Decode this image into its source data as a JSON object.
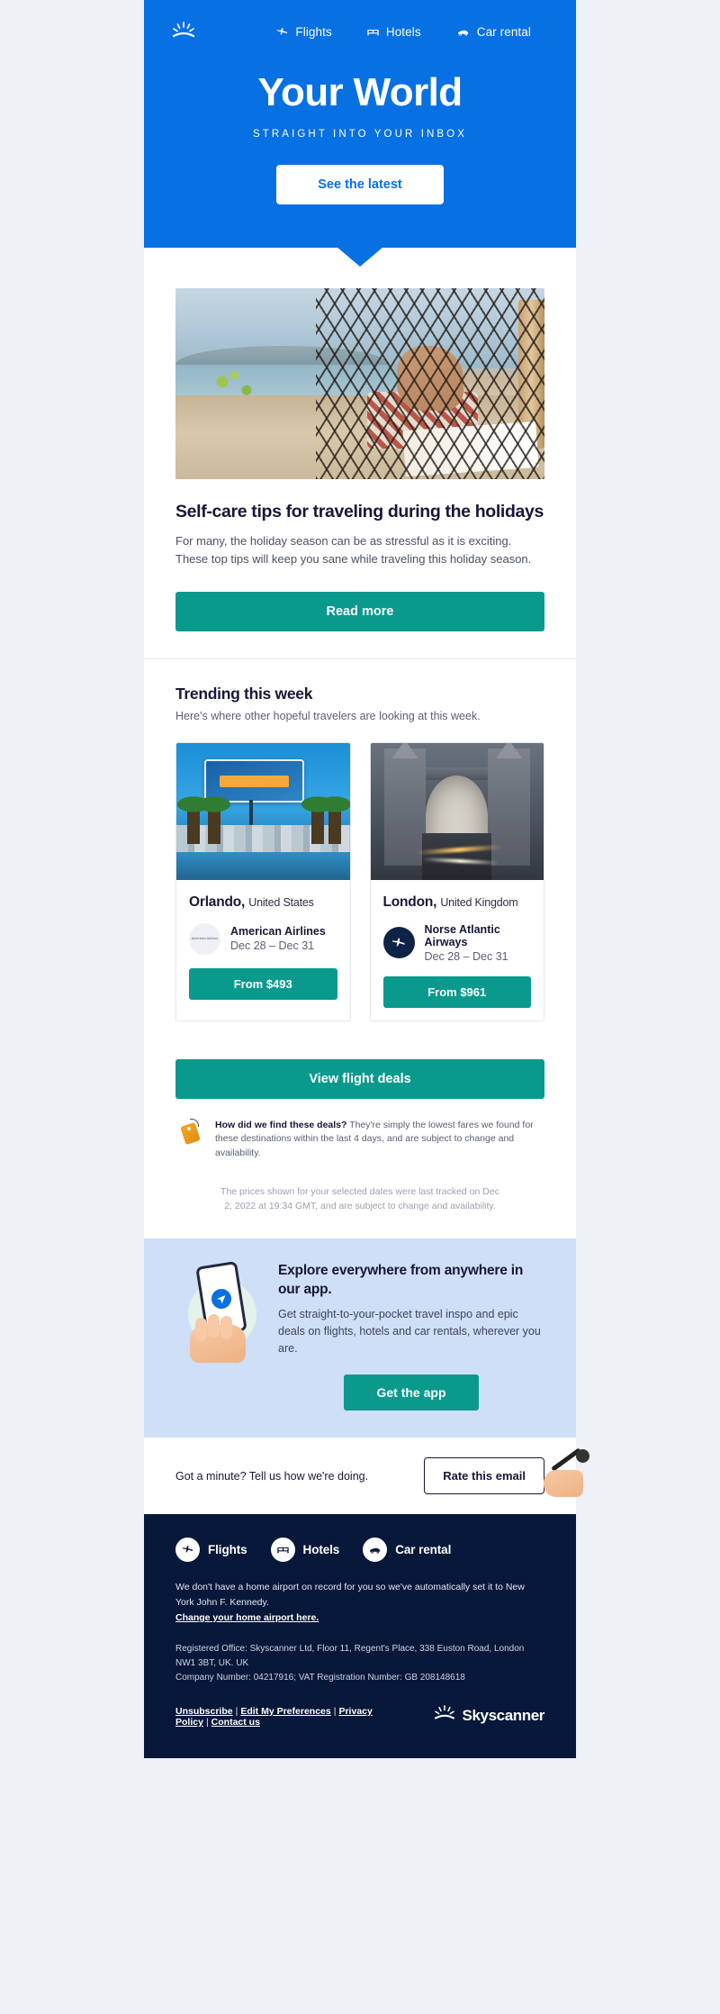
{
  "hero": {
    "logo_name": "skyscanner-sun-logo",
    "nav": [
      {
        "label": "Flights",
        "icon": "plane-icon"
      },
      {
        "label": "Hotels",
        "icon": "bed-icon"
      },
      {
        "label": "Car rental",
        "icon": "car-icon"
      }
    ],
    "title": "Your World",
    "subtitle": "STRAIGHT INTO YOUR INBOX",
    "cta_label": "See the latest",
    "bg_color": "#0770e3"
  },
  "article": {
    "image_alt": "person relaxing in a hammock on a beach reading a book",
    "title": "Self-care tips for traveling during the holidays",
    "body": "For many, the holiday season can be as stressful as it is exciting. These top tips will keep you sane while traveling this holiday season.",
    "cta_label": "Read more"
  },
  "trending": {
    "title": "Trending this week",
    "subtitle": "Here's where other hopeful travelers are looking at this week.",
    "cards": [
      {
        "image_alt": "Welcome to Orlando sign with palm trees",
        "city": "Orlando,",
        "country": "United States",
        "airline": "American Airlines",
        "airline_logo": "american-airlines-logo",
        "dates": "Dec 28 – Dec 31",
        "price_label": "From $493"
      },
      {
        "image_alt": "Tower Bridge London with light trails",
        "city": "London,",
        "country": "United Kingdom",
        "airline": "Norse Atlantic Airways",
        "airline_logo": "norse-atlantic-airways-logo",
        "dates": "Dec 28 – Dec 31",
        "price_label": "From $961"
      }
    ],
    "deals_cta": "View flight deals",
    "note_bold": "How did we find these deals?",
    "note_rest": " They're simply the lowest fares we found for these destinations within the last 4 days, and are subject to change and availability.",
    "tracking_note": "The prices shown for your selected dates were last tracked on Dec 2, 2022 at 19:34 GMT, and are subject to change and availability."
  },
  "app_promo": {
    "title": "Explore everywhere from anywhere in our app.",
    "body": "Get straight-to-your-pocket travel inspo and epic deals on flights, hotels and car rentals, wherever you are.",
    "cta_label": "Get the app",
    "bg_color": "#cfdff8"
  },
  "feedback": {
    "text": "Got a minute? Tell us how we're doing.",
    "button_label": "Rate this email",
    "illustration": "hand-holding-microphone"
  },
  "footer": {
    "nav": [
      {
        "label": "Flights",
        "icon": "plane-icon"
      },
      {
        "label": "Hotels",
        "icon": "bed-icon"
      },
      {
        "label": "Car rental",
        "icon": "car-icon"
      }
    ],
    "airport_note": "We don't have a home airport on record for you so we've automatically set it to New York John F. Kennedy.",
    "airport_link": "Change your home airport here.",
    "legal_line1": "Registered Office: Skyscanner Ltd, Floor 11, Regent's Place, 338 Euston Road, London NW1 3BT, UK. UK",
    "legal_line2": "Company Number: 04217916; VAT Registration Number: GB 208148618",
    "links": [
      {
        "label": "Unsubscribe"
      },
      {
        "label": "Edit My Preferences"
      },
      {
        "label": "Privacy Policy"
      },
      {
        "label": "Contact us"
      }
    ],
    "link_separator": "|",
    "brand": "Skyscanner",
    "bg_color": "#08183a"
  }
}
